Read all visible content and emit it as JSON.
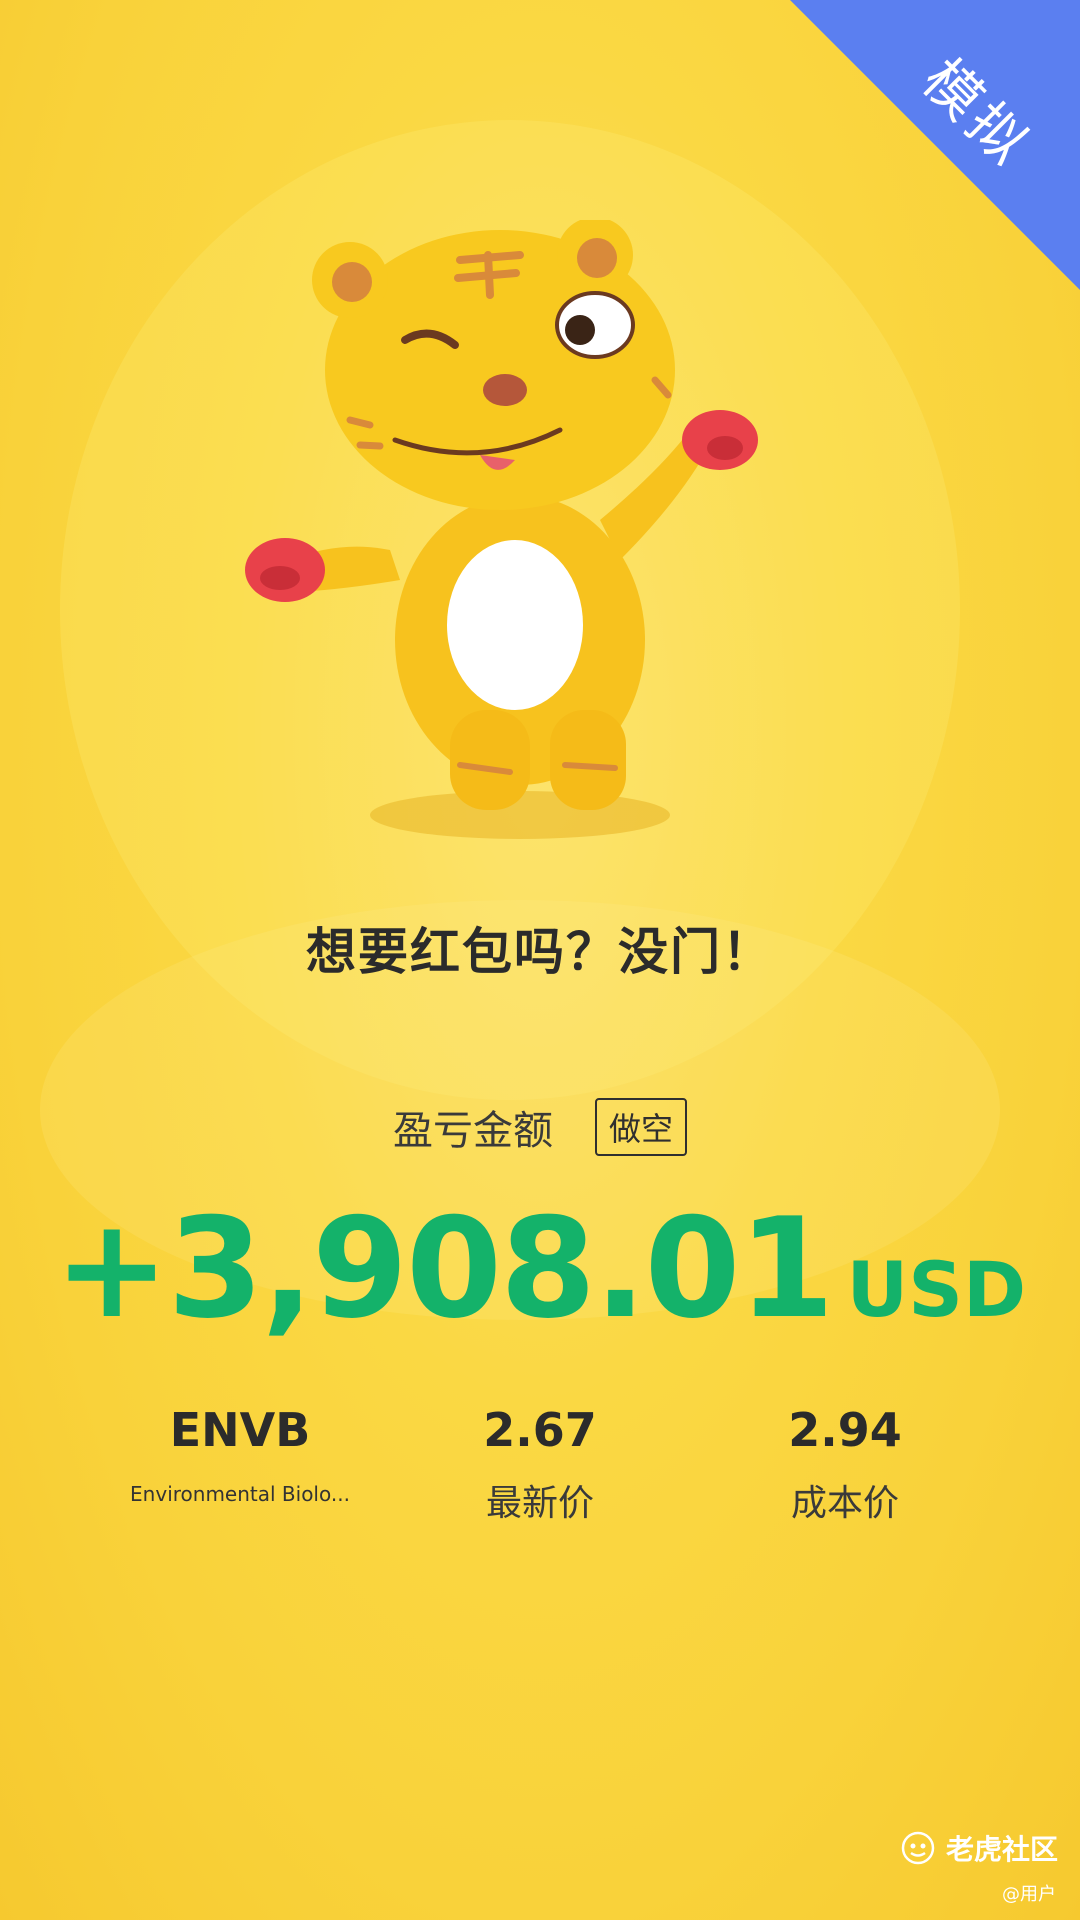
{
  "corner_badge": {
    "label": "模拟"
  },
  "headline": "想要红包吗？没门！",
  "pnl": {
    "label": "盈亏金额",
    "direction_tag": "做空",
    "amount": "+3,908.01",
    "currency": "USD"
  },
  "stock": {
    "symbol": "ENVB",
    "name": "Environmental Biolo..."
  },
  "prices": {
    "latest": {
      "value": "2.67",
      "label": "最新价"
    },
    "cost": {
      "value": "2.94",
      "label": "成本价"
    }
  },
  "watermark": {
    "brand": "老虎社区",
    "user": "@用户"
  },
  "colors": {
    "background": "#f9d23a",
    "badge": "#5b7ff0",
    "profit_green": "#14b26a",
    "text_dark": "#2b2b2b"
  },
  "icons": [
    "tiger-mascot-illustration",
    "tiger-community-logo-icon"
  ]
}
